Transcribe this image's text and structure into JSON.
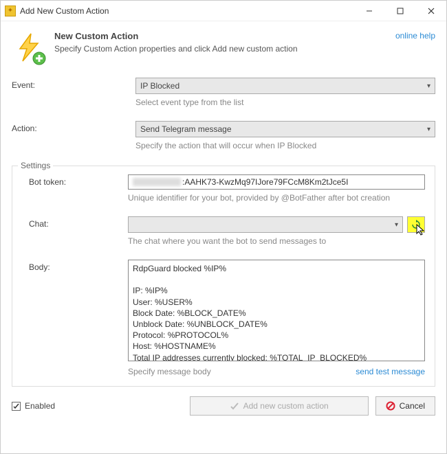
{
  "window": {
    "title": "Add New Custom Action"
  },
  "header": {
    "title": "New Custom Action",
    "subtitle": "Specify Custom Action properties and click Add new custom action",
    "help_link": "online help"
  },
  "event": {
    "label": "Event:",
    "value": "IP Blocked",
    "help": "Select event type from the list"
  },
  "action": {
    "label": "Action:",
    "value": "Send Telegram message",
    "help": "Specify the action that will occur when IP Blocked"
  },
  "settings": {
    "legend": "Settings",
    "bot_token": {
      "label": "Bot token:",
      "value_visible": ":AAHK73-KwzMq97IJore79FCcM8Km2tJce5I",
      "help": "Unique identifier for your bot, provided by @BotFather after bot creation"
    },
    "chat": {
      "label": "Chat:",
      "value": "",
      "help": "The chat where you want the bot to send messages to"
    },
    "body": {
      "label": "Body:",
      "value": "RdpGuard blocked %IP%\n\nIP: %IP%\nUser: %USER%\nBlock Date: %BLOCK_DATE%\nUnblock Date: %UNBLOCK_DATE%\nProtocol: %PROTOCOL%\nHost: %HOSTNAME%\nTotal IP addresses currently blocked: %TOTAL_IP_BLOCKED%",
      "help": "Specify message body",
      "test_link": "send test message"
    }
  },
  "footer": {
    "enabled_label": "Enabled",
    "enabled_checked": true,
    "add_button": "Add new custom action",
    "cancel_button": "Cancel"
  }
}
